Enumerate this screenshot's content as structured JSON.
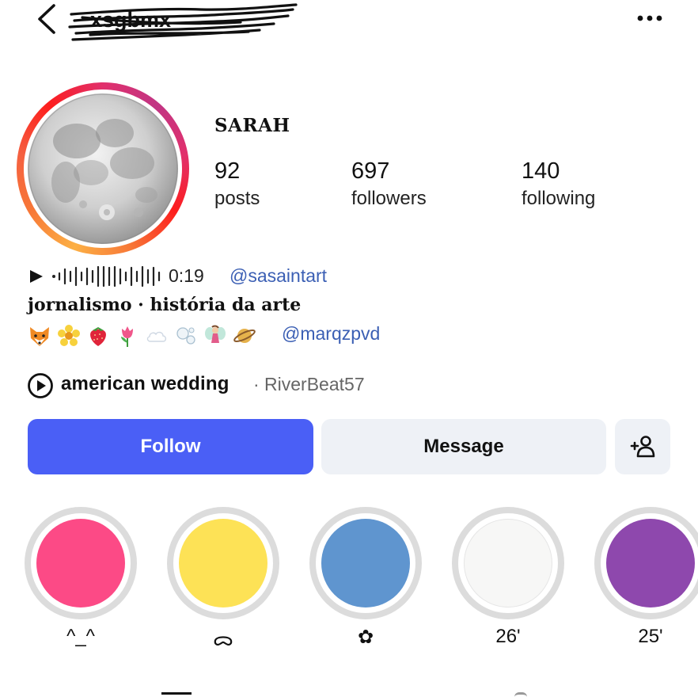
{
  "header": {
    "username": "xsgbmx",
    "back_icon": "chevron-left-icon",
    "more_icon": "more-horizontal-icon"
  },
  "profile": {
    "display_name": "SARAH",
    "avatar": "full-moon-photo",
    "stats": {
      "posts": "92",
      "posts_label": "posts",
      "followers": "697",
      "followers_label": "followers",
      "following": "140",
      "following_label": "following"
    },
    "audio": {
      "waveform": "·ıllıllıllıllllıllıllıl",
      "duration": "0:19",
      "mention": "@sasaintart"
    },
    "bio_line": "jornalismo · história da arte",
    "bio_emoji": [
      "fox",
      "blossom",
      "strawberry",
      "tulip",
      "cloud",
      "bubbles",
      "fairy",
      "saturn"
    ],
    "bio_mention": "@marqzpvd",
    "music": {
      "title": "american wedding",
      "artist": "· RiverBeat57"
    }
  },
  "actions": {
    "follow_label": "Follow",
    "message_label": "Message",
    "add_user_icon": "add-user-icon",
    "follow_color": "#4a5ff6"
  },
  "highlights": [
    {
      "label": "^_^",
      "color": "#fc4a86"
    },
    {
      "label": "ᯅ",
      "color": "#fde256"
    },
    {
      "label": "✿",
      "color": "#5f95cf"
    },
    {
      "label": "26'",
      "color": "#f7f7f6"
    },
    {
      "label": "25'",
      "color": "#8e48ad"
    }
  ]
}
